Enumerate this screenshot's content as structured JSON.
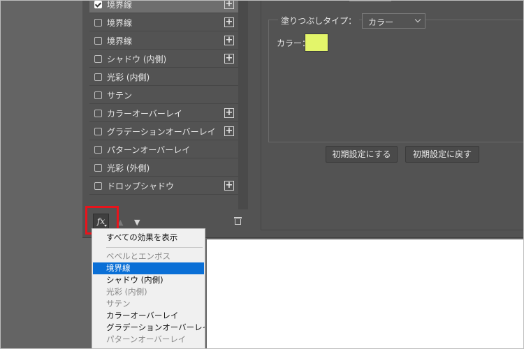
{
  "styles_list": [
    {
      "label": "境界線",
      "checked": true,
      "has_add": true
    },
    {
      "label": "境界線",
      "checked": false,
      "has_add": true
    },
    {
      "label": "境界線",
      "checked": false,
      "has_add": true
    },
    {
      "label": "シャドウ (内側)",
      "checked": false,
      "has_add": true
    },
    {
      "label": "光彩 (内側)",
      "checked": false,
      "has_add": false
    },
    {
      "label": "サテン",
      "checked": false,
      "has_add": false
    },
    {
      "label": "カラーオーバーレイ",
      "checked": false,
      "has_add": true
    },
    {
      "label": "グラデーションオーバーレイ",
      "checked": false,
      "has_add": true
    },
    {
      "label": "パターンオーバーレイ",
      "checked": false,
      "has_add": false
    },
    {
      "label": "光彩 (外側)",
      "checked": false,
      "has_add": false
    },
    {
      "label": "ドロップシャドウ",
      "checked": false,
      "has_add": true
    }
  ],
  "toolbar": {
    "fx_label": "fx"
  },
  "fill": {
    "type_label": "塗りつぶしタイプ：",
    "type_value": "カラー",
    "color_label": "カラー：",
    "color_value": "#e3f56a"
  },
  "buttons": {
    "set_default": "初期設定にする",
    "reset_default": "初期設定に戻す"
  },
  "menu": {
    "show_all": "すべての効果を表示",
    "items": [
      {
        "label": "ベベルとエンボス",
        "state": "disabled"
      },
      {
        "label": "境界線",
        "state": "selected"
      },
      {
        "label": "シャドウ (内側)",
        "state": "enabled"
      },
      {
        "label": "光彩 (内側)",
        "state": "disabled"
      },
      {
        "label": "サテン",
        "state": "disabled"
      },
      {
        "label": "カラーオーバーレイ",
        "state": "enabled"
      },
      {
        "label": "グラデーションオーバーレイ",
        "state": "enabled"
      },
      {
        "label": "パターンオーバーレイ",
        "state": "disabled"
      }
    ]
  },
  "colors": {
    "selection": "#0a6fd6",
    "highlight_box": "#e8141c"
  }
}
